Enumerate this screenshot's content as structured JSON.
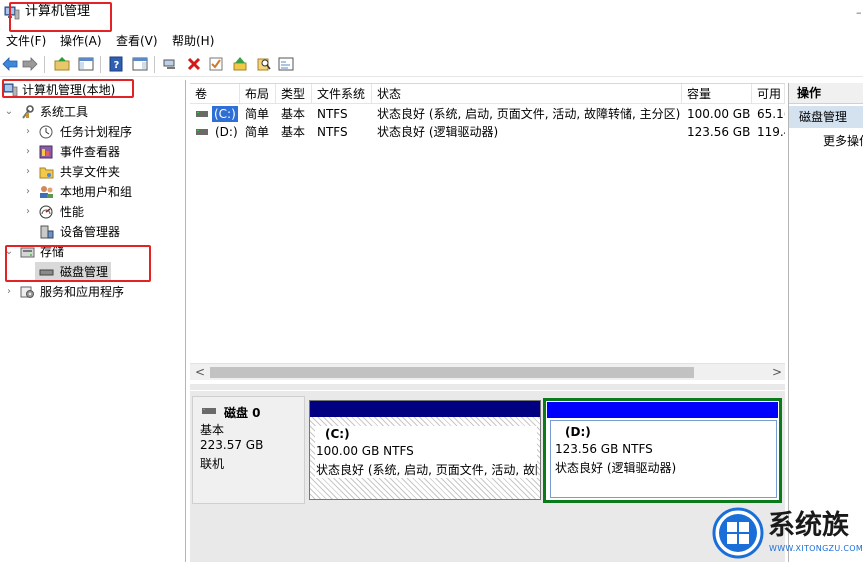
{
  "window": {
    "title": "计算机管理",
    "minimize_glyph": "–"
  },
  "menu": {
    "items": [
      "文件(F)",
      "操作(A)",
      "查看(V)",
      "帮助(H)"
    ]
  },
  "toolbar": {
    "icons": [
      "back-arrow-icon",
      "forward-arrow-icon",
      "up-folder-icon",
      "show-hide-tree-icon",
      "help-icon",
      "action-pane-icon",
      "connect-icon",
      "delete-icon",
      "check-icon",
      "up-arrow-icon",
      "search-icon",
      "properties-icon"
    ]
  },
  "tree": {
    "root": "计算机管理(本地)",
    "system_tools": "系统工具",
    "task_scheduler": "任务计划程序",
    "event_viewer": "事件查看器",
    "shared_folders": "共享文件夹",
    "local_users": "本地用户和组",
    "performance": "性能",
    "device_manager": "设备管理器",
    "storage": "存储",
    "disk_management": "磁盘管理",
    "services": "服务和应用程序"
  },
  "volumes": {
    "headers": [
      "卷",
      "布局",
      "类型",
      "文件系统",
      "状态",
      "容量",
      "可用"
    ],
    "rows": [
      {
        "volume": "(C:)",
        "layout": "简单",
        "type": "基本",
        "fs": "NTFS",
        "status": "状态良好 (系统, 启动, 页面文件, 活动, 故障转储, 主分区)",
        "capacity": "100.00 GB",
        "free": "65.1("
      },
      {
        "volume": "(D:)",
        "layout": "简单",
        "type": "基本",
        "fs": "NTFS",
        "status": "状态良好 (逻辑驱动器)",
        "capacity": "123.56 GB",
        "free": "119.4"
      }
    ]
  },
  "scroll": {
    "left": "<",
    "right": ">"
  },
  "disk": {
    "name": "磁盘 0",
    "type": "基本",
    "size": "223.57 GB",
    "state": "联机",
    "partitions": [
      {
        "label": "(C:)",
        "size": "100.00 GB NTFS",
        "status": "状态良好 (系统, 启动, 页面文件, 活动, 故障"
      },
      {
        "label": "(D:)",
        "size": "123.56 GB NTFS",
        "status": "状态良好 (逻辑驱动器)"
      }
    ]
  },
  "actions": {
    "title": "操作",
    "context": "磁盘管理",
    "more": "更多操作"
  },
  "watermark": {
    "brand": "系统族",
    "url": "WWW.XITONGZU.COM"
  },
  "colors": {
    "highlight_red": "#e32323",
    "primary_partition": "#000080",
    "logical_partition": "#0000ff",
    "selected_border": "#0a7a1a"
  }
}
